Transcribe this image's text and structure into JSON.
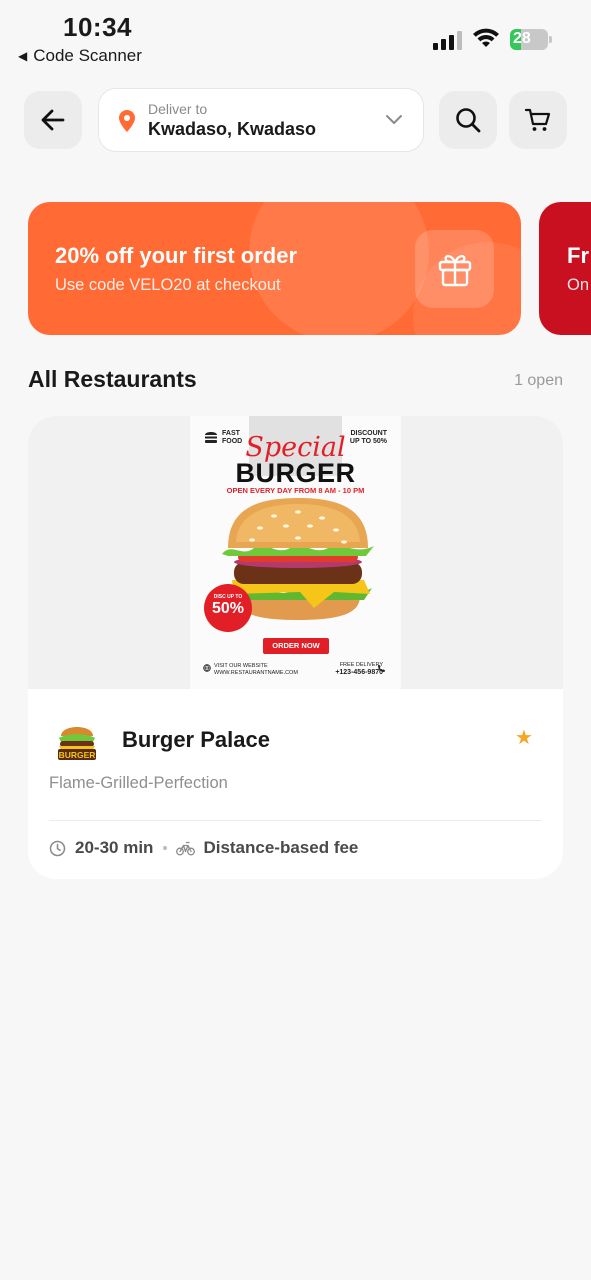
{
  "status_bar": {
    "time": "10:34",
    "back_app_label": "Code Scanner",
    "battery_level": 28,
    "battery_text": "28",
    "battery_color": "#34c759"
  },
  "header": {
    "back_icon": "arrow-left-icon",
    "deliver_label": "Deliver to",
    "address": "Kwadaso, Kwadaso",
    "location_icon": "map-pin-icon",
    "search_icon": "search-icon",
    "cart_icon": "cart-icon",
    "accent_color": "#ff6a35"
  },
  "promos": [
    {
      "title": "20% off your first order",
      "subtitle": "Use code VELO20 at checkout",
      "icon": "gift-icon",
      "color": "#ff6a35"
    },
    {
      "title": "Fr",
      "subtitle": "On",
      "color": "#c81020"
    }
  ],
  "restaurants_section": {
    "title": "All Restaurants",
    "count": "1 open"
  },
  "restaurants": [
    {
      "name": "Burger Palace",
      "tagline": "Flame-Grilled-Perfection",
      "delivery_time": "20-30 min",
      "fee": "Distance-based fee",
      "favorite": true,
      "poster": {
        "fast_food": "FAST FOOD",
        "discount": "DISCOUNT UP TO 50%",
        "special": "Special",
        "burger": "BURGER",
        "hours": "OPEN EVERY DAY FROM 8 AM - 10 PM",
        "badge_small": "DISC UP TO",
        "badge_big": "50%",
        "order_now": "ORDER NOW",
        "visit": "VISIT OUR WEBSITE",
        "website": "WWW.RESTAURANTNAME.COM",
        "free_delivery": "FREE DELIVERY",
        "phone": "+123-456-9870"
      },
      "logo_text": "BURGER"
    }
  ]
}
